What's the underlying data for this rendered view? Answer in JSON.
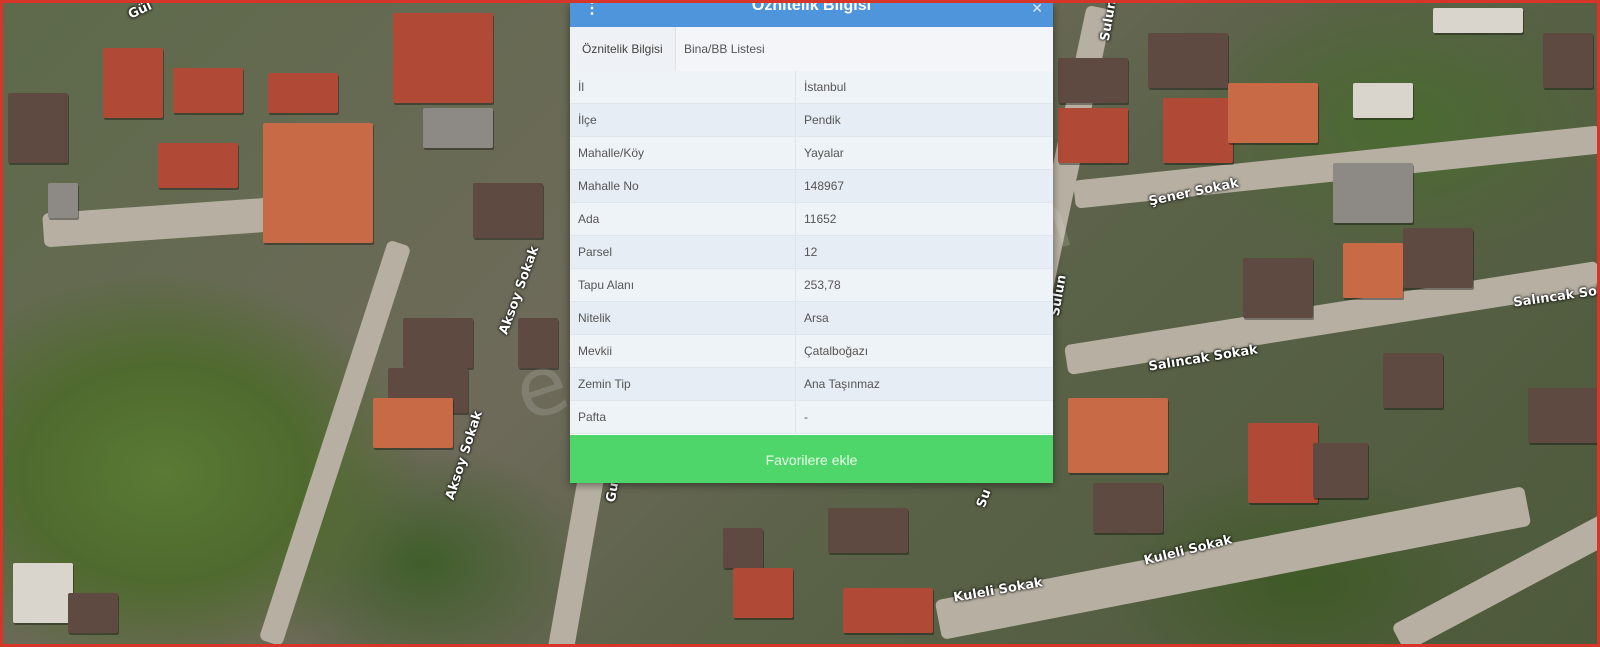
{
  "panel": {
    "title": "Öznitelik Bilgisi",
    "menu_icon": "more-vertical-icon",
    "close_icon": "close-icon",
    "tabs": [
      {
        "label": "Öznitelik Bilgisi",
        "active": true
      },
      {
        "label": "Bina/BB Listesi",
        "active": false
      }
    ],
    "rows": [
      {
        "key": "İl",
        "value": "İstanbul"
      },
      {
        "key": "İlçe",
        "value": "Pendik"
      },
      {
        "key": "Mahalle/Köy",
        "value": "Yayalar"
      },
      {
        "key": "Mahalle No",
        "value": "148967"
      },
      {
        "key": "Ada",
        "value": "11652"
      },
      {
        "key": "Parsel",
        "value": "12"
      },
      {
        "key": "Tapu Alanı",
        "value": "253,78"
      },
      {
        "key": "Nitelik",
        "value": "Arsa"
      },
      {
        "key": "Mevkii",
        "value": "Çatalboğazı"
      },
      {
        "key": "Zemin Tip",
        "value": "Ana Taşınmaz"
      },
      {
        "key": "Pafta",
        "value": "-"
      }
    ],
    "favorite_button": "Favorilere ekle",
    "header_color": "#4e95dc",
    "button_color": "#4fd66a"
  },
  "map": {
    "streets": {
      "gul": "Gül",
      "aksoy_1": "Aksoy Sokak",
      "aksoy_2": "Aksoy Sokak",
      "sulun_top": "Sulun",
      "sulun_mid": "Sulun",
      "sener": "Şener Sokak",
      "salincak_1": "Salıncak Sokak",
      "salincak_2": "Salıncak Sokak",
      "kuleli_1": "Kuleli Sokak",
      "kuleli_2": "Kuleli Sokak",
      "gu_bottom": "Gu",
      "su_bottom": "Su"
    },
    "watermark": "emlakjet.com",
    "border_color": "#d8352a"
  }
}
